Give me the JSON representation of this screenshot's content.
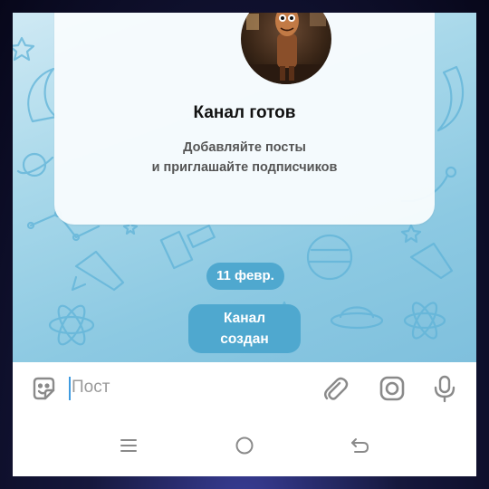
{
  "channel_card": {
    "title": "Канал готов",
    "description_line1": "Добавляйте посты",
    "description_line2": "и приглашайте подписчиков"
  },
  "messages": {
    "date_badge": "11 февр.",
    "service_line1": "Канал",
    "service_line2": "создан"
  },
  "composer": {
    "placeholder": "Пост",
    "value": ""
  },
  "icons": {
    "sticker": "sticker-icon",
    "attach": "paperclip-icon",
    "camera": "camera-icon",
    "mic": "microphone-icon"
  },
  "colors": {
    "accent": "#4fa8cf",
    "icon": "#8a8a8a",
    "caret": "#3f9be0"
  }
}
